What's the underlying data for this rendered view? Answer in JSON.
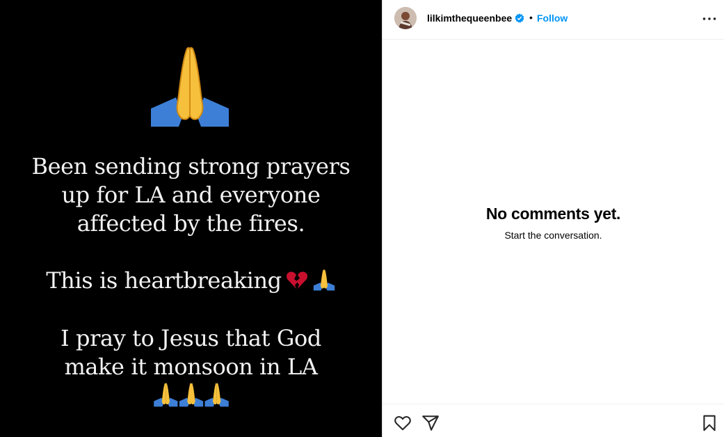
{
  "post": {
    "text_block_1": [
      "Been sending strong prayers",
      "up for LA and everyone",
      "affected by the fires."
    ],
    "text_block_2": "This is heartbreaking",
    "text_block_3": [
      "I pray to Jesus that God",
      "make it monsoon in LA"
    ],
    "emoji": {
      "header": "folded-hands-emoji",
      "inline": [
        "broken-heart-emoji",
        "folded-hands-emoji"
      ],
      "footer": [
        "folded-hands-emoji",
        "folded-hands-emoji",
        "folded-hands-emoji"
      ]
    },
    "background_color": "#000000",
    "text_color": "#f2f2f2"
  },
  "header": {
    "username": "lilkimthequeenbee",
    "verified": true,
    "separator": "•",
    "follow_label": "Follow",
    "accent_color": "#0095f6"
  },
  "comments": {
    "empty_title": "No comments yet.",
    "empty_subtitle": "Start the conversation."
  },
  "actions": {
    "icons": [
      "heart-icon",
      "share-icon",
      "bookmark-icon"
    ]
  }
}
